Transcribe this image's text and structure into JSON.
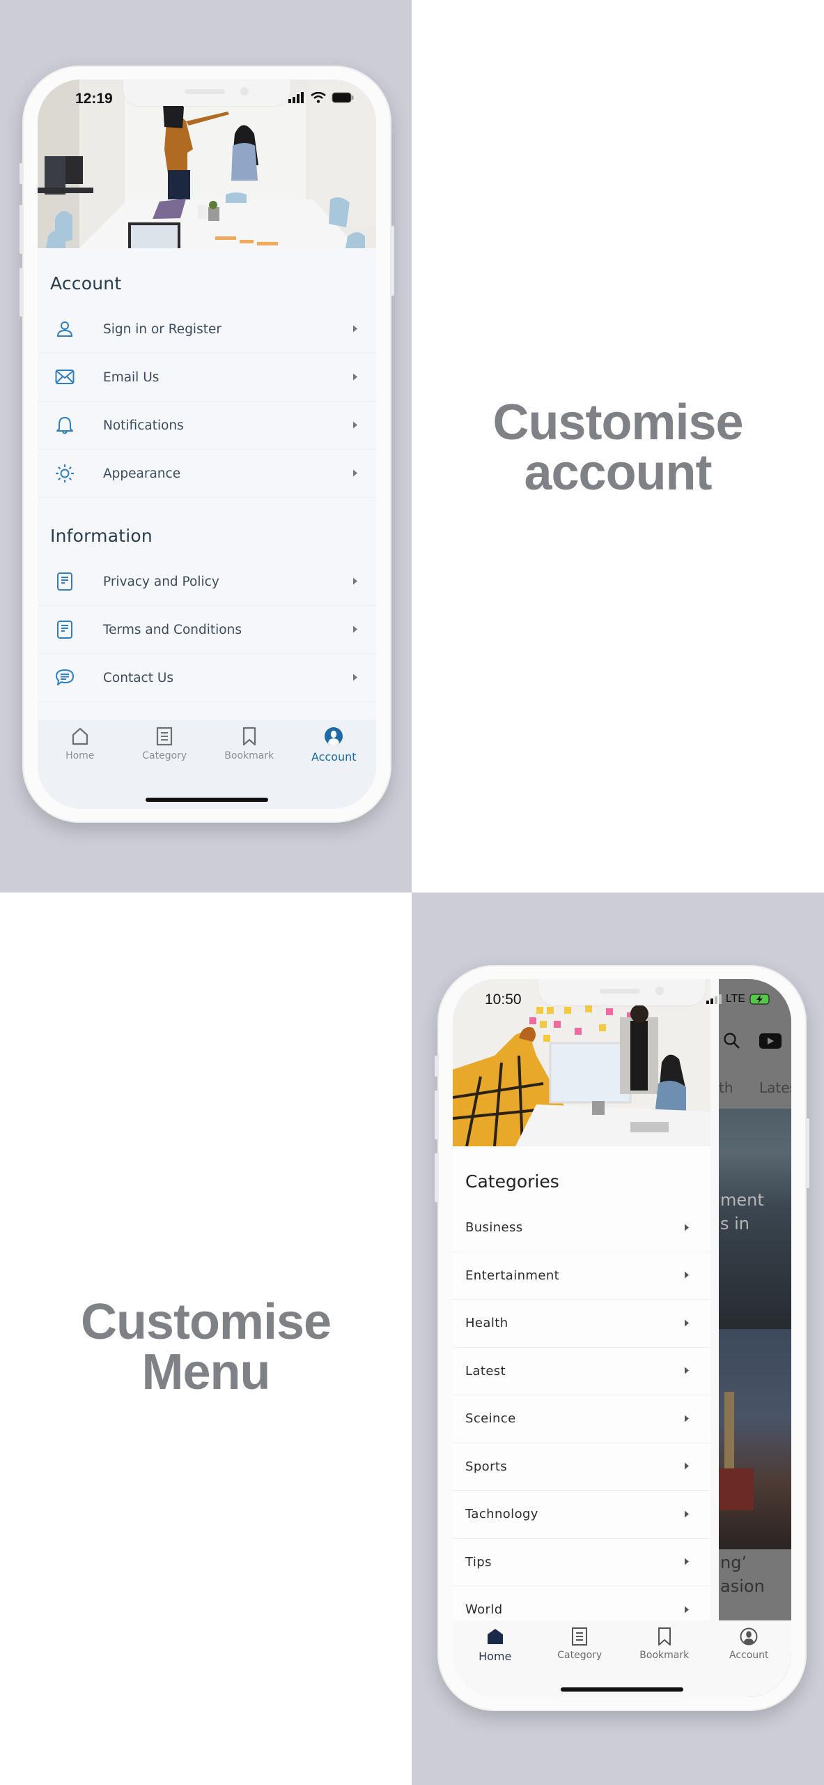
{
  "panels": {
    "account": {
      "caption_line1": "Customise",
      "caption_line2": "account"
    },
    "menu": {
      "caption_line1": "Customise",
      "caption_line2": "Menu"
    }
  },
  "account_screen": {
    "status": {
      "time": "12:19",
      "icons": [
        "signal-icon",
        "wifi-icon",
        "battery-icon"
      ]
    },
    "sections": [
      {
        "title": "Account",
        "items": [
          {
            "label": "Sign in or Register",
            "icon": "user-icon"
          },
          {
            "label": "Email Us",
            "icon": "mail-icon"
          },
          {
            "label": "Notifications",
            "icon": "bell-icon"
          },
          {
            "label": "Appearance",
            "icon": "sun-icon"
          }
        ]
      },
      {
        "title": "Information",
        "items": [
          {
            "label": "Privacy and Policy",
            "icon": "document-icon"
          },
          {
            "label": "Terms and Conditions",
            "icon": "document-icon"
          },
          {
            "label": "Contact Us",
            "icon": "chat-icon"
          }
        ]
      }
    ],
    "tabbar": [
      {
        "label": "Home",
        "icon": "home-icon",
        "active": false
      },
      {
        "label": "Category",
        "icon": "category-icon",
        "active": false
      },
      {
        "label": "Bookmark",
        "icon": "bookmark-icon",
        "active": false
      },
      {
        "label": "Account",
        "icon": "account-icon",
        "active": true
      }
    ],
    "accent_color": "#1d6aa5"
  },
  "menu_screen": {
    "status": {
      "time": "10:50",
      "network": "LTE",
      "icons": [
        "signal-icon",
        "battery-charging-icon"
      ]
    },
    "background_app": {
      "tabs_partial": [
        "th",
        "Lates"
      ],
      "headline1_partial": [
        "ment",
        "s in"
      ],
      "headline2_partial": [
        "ng’",
        "asion"
      ]
    },
    "drawer": {
      "title": "Categories",
      "items": [
        "Business",
        "Entertainment",
        "Health",
        "Latest",
        "Sceince",
        "Sports",
        "Tachnology",
        "Tips",
        "World"
      ]
    },
    "tabbar": [
      {
        "label": "Home",
        "icon": "home-icon",
        "active": true
      },
      {
        "label": "Category",
        "icon": "category-icon",
        "active": false
      },
      {
        "label": "Bookmark",
        "icon": "bookmark-icon",
        "active": false
      },
      {
        "label": "Account",
        "icon": "account-icon",
        "active": false
      }
    ],
    "accent_color": "#1b2a4a"
  }
}
